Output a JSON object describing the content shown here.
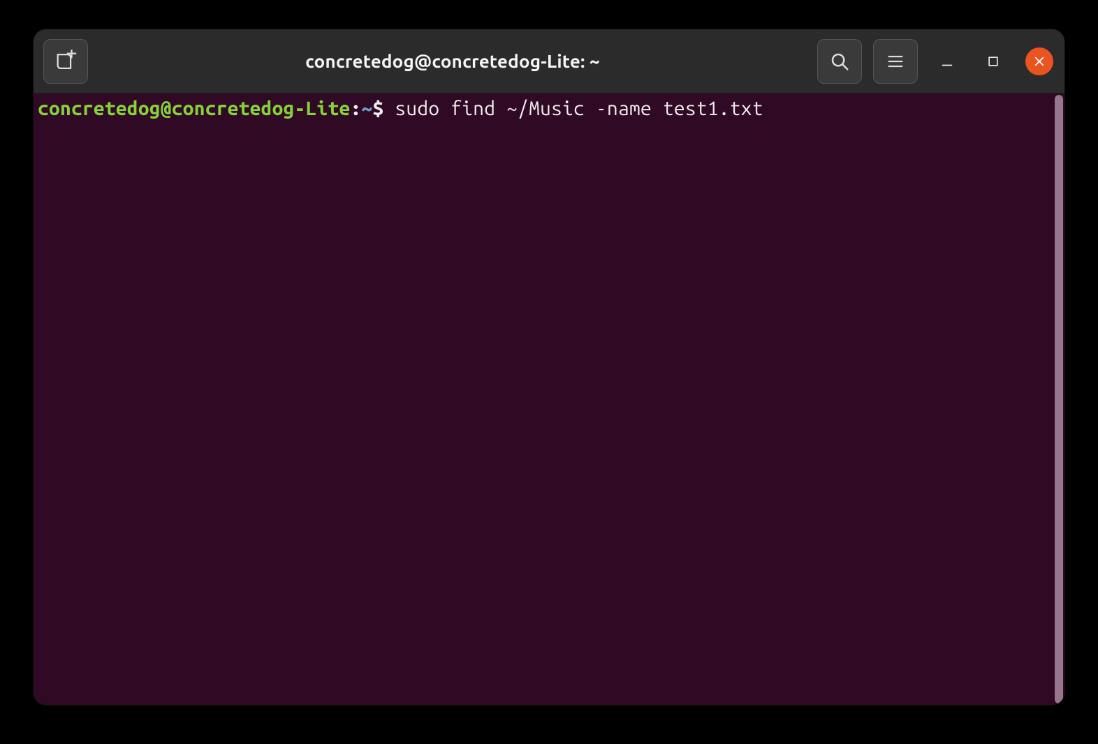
{
  "window": {
    "title": "concretedog@concretedog-Lite: ~"
  },
  "prompt": {
    "user_host": "concretedog@concretedog-Lite",
    "separator": ":",
    "path": "~",
    "prompt_symbol": "$ ",
    "command": "sudo find ~/Music -name test1.txt"
  },
  "icons": {
    "new_tab": "new-tab-icon",
    "search": "search-icon",
    "menu": "hamburger-icon",
    "minimize": "minimize-icon",
    "maximize": "maximize-icon",
    "close": "close-icon"
  },
  "colors": {
    "bg": "#300a24",
    "titlebar": "#2b2b2b",
    "accent_close": "#e95420",
    "prompt_user": "#87d13a",
    "prompt_path": "#6aa0c8",
    "text": "#eeeeee"
  }
}
